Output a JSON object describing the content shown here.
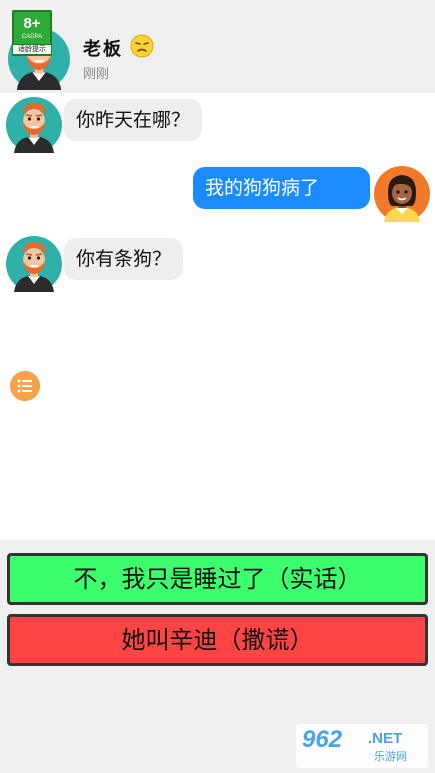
{
  "age_rating": {
    "number": "8+",
    "code": "CADPA",
    "tip": "适龄提示"
  },
  "header": {
    "name": "老板",
    "emoji": "worried-face-icon",
    "status": "刚刚"
  },
  "messages": [
    {
      "side": "in",
      "text": "你昨天在哪？",
      "avatar": "boss-avatar"
    },
    {
      "side": "out",
      "text": "我的狗狗病了",
      "avatar": "player-avatar"
    },
    {
      "side": "in",
      "text": "你有条狗？",
      "avatar": "boss-avatar"
    }
  ],
  "menu": {
    "icon": "list-menu-icon"
  },
  "choices": [
    {
      "label": "不，我只是睡过了（实话）",
      "color": "#3dff6e"
    },
    {
      "label": "她叫辛迪（撒谎）",
      "color": "#ff4444"
    }
  ],
  "watermark": {
    "brand": "962",
    "domain": ".NET",
    "subtitle": "乐游网"
  },
  "colors": {
    "header_bg": "#f0f0f0",
    "bubble_in": "#eeeeee",
    "bubble_out": "#1a8cff",
    "boss_bg": "#2fa8a8",
    "player_bg": "#f07a2a"
  }
}
